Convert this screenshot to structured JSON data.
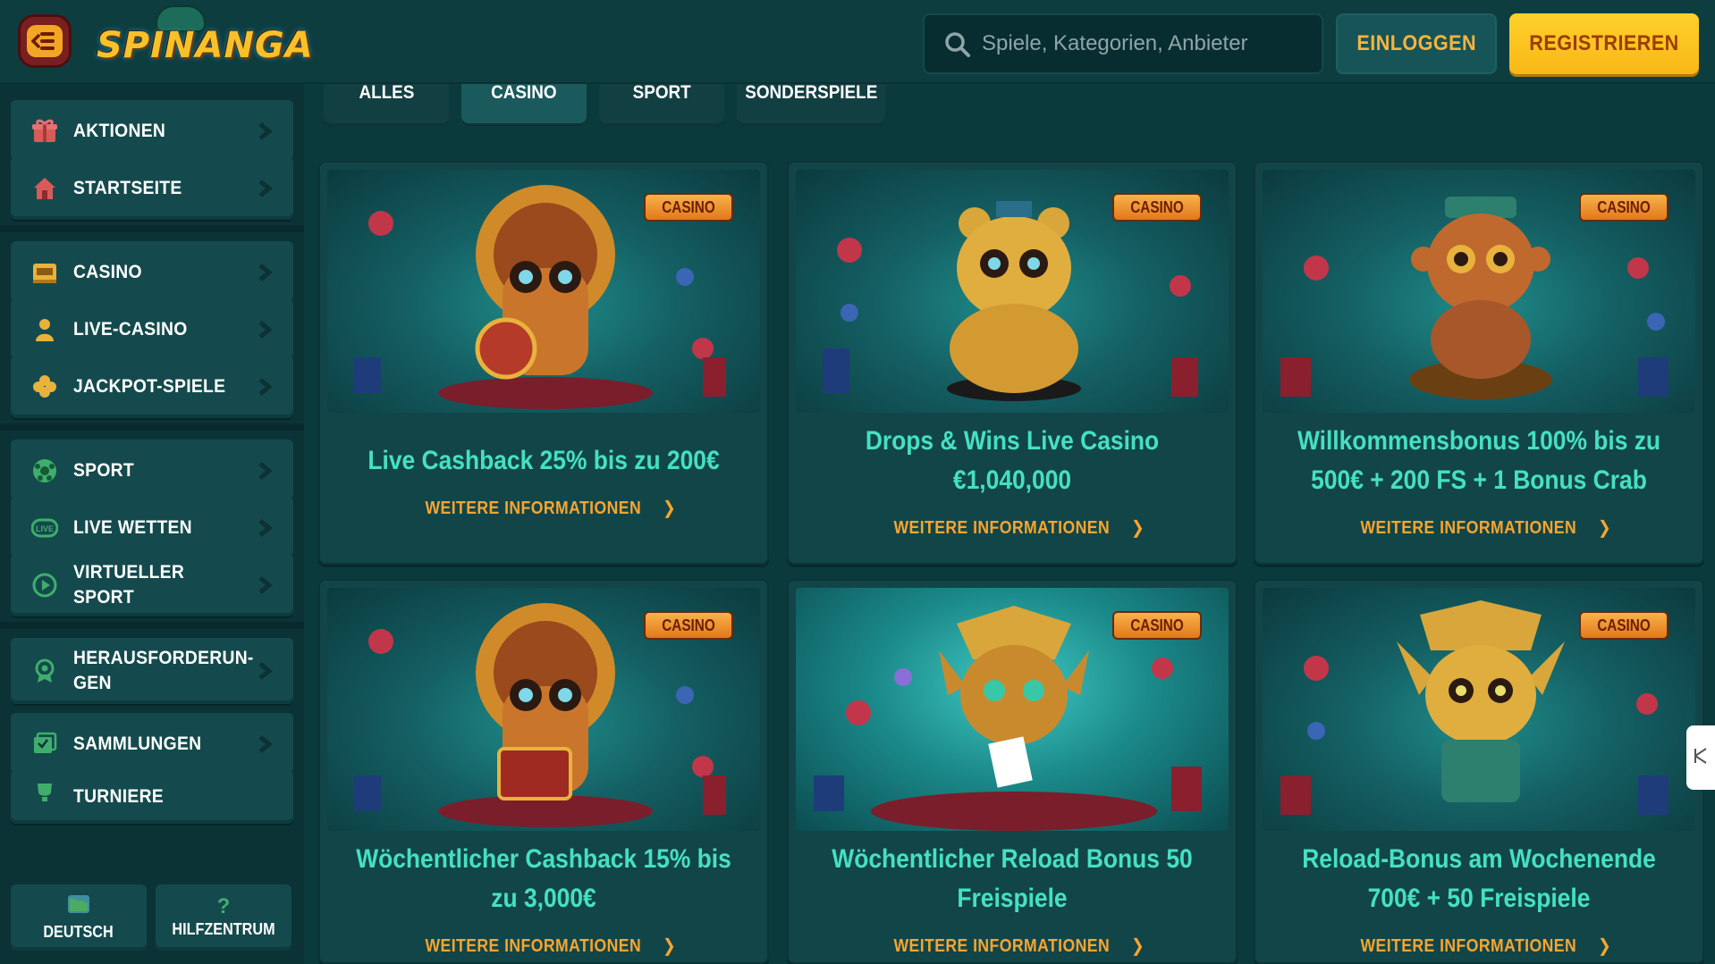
{
  "header": {
    "logo_text": "SPINANGA",
    "search_placeholder": "Spiele, Kategorien, Anbieter",
    "login_label": "EINLOGGEN",
    "register_label": "REGISTRIEREN"
  },
  "sidebar": {
    "items": [
      {
        "label": "AKTIONEN",
        "icon": "gift-icon"
      },
      {
        "label": "STARTSEITE",
        "icon": "home-icon"
      },
      {
        "label": "CASINO",
        "icon": "slot-machine-icon"
      },
      {
        "label": "LIVE-CASINO",
        "icon": "dealer-icon"
      },
      {
        "label": "JACKPOT-SPIELE",
        "icon": "clover-icon"
      },
      {
        "label": "SPORT",
        "icon": "soccer-ball-icon"
      },
      {
        "label": "LIVE WETTEN",
        "icon": "live-icon"
      },
      {
        "label": "VIRTUELLER SPORT",
        "icon": "play-circle-icon"
      },
      {
        "label": "HERAUSFORDERUN-GEN",
        "icon": "badge-icon"
      },
      {
        "label": "SAMMLUNGEN",
        "icon": "collection-icon"
      },
      {
        "label": "TURNIERE",
        "icon": "trophy-icon"
      }
    ],
    "language_label": "DEUTSCH",
    "help_label": "HILFZENTRUM"
  },
  "tabs": [
    {
      "label": "ALLES",
      "active": false
    },
    {
      "label": "CASINO",
      "active": true
    },
    {
      "label": "SPORT",
      "active": false
    },
    {
      "label": "SONDERSPIELE",
      "active": false
    }
  ],
  "promotions": [
    {
      "badge": "CASINO",
      "title": "Live Cashback 25% bis zu 200€",
      "more": "WEITERE INFORMATIONEN"
    },
    {
      "badge": "CASINO",
      "title": "Drops & Wins Live Casino €1,040,000",
      "more": "WEITERE INFORMATIONEN"
    },
    {
      "badge": "CASINO",
      "title": "Willkommensbonus 100% bis zu 500€ + 200 FS + 1 Bonus Crab",
      "more": "WEITERE INFORMATIONEN"
    },
    {
      "badge": "CASINO",
      "title": "Wöchentlicher Cashback 15% bis zu 3,000€",
      "more": "WEITERE INFORMATIONEN"
    },
    {
      "badge": "CASINO",
      "title": "Wöchentlicher Reload Bonus 50 Freispiele",
      "more": "WEITERE INFORMATIONEN"
    },
    {
      "badge": "CASINO",
      "title": "Reload-Bonus am Wochenende 700€ + 50 Freispiele",
      "more": "WEITERE INFORMATIONEN"
    }
  ],
  "colors": {
    "background": "#0b3a3d",
    "accent_orange": "#f7a530",
    "title_teal": "#45e0c2",
    "register_yellow": "#ffd12b"
  }
}
